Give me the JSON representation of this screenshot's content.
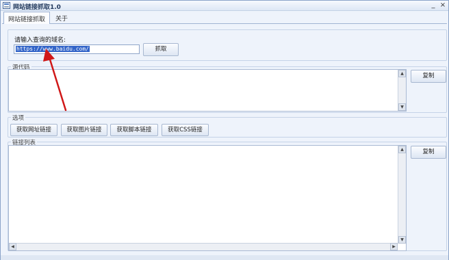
{
  "window": {
    "title": "网站链接抓取1.0",
    "minimize": "_",
    "close": "×"
  },
  "tabs": [
    {
      "label": "网站链接抓取"
    },
    {
      "label": "关于"
    }
  ],
  "url_section": {
    "prompt": "请输入查询的域名:",
    "input_value": "https://www.baidu.com/",
    "fetch_button": "抓取"
  },
  "source_section": {
    "legend": "源代码",
    "content": "",
    "copy_button": "复制"
  },
  "options_section": {
    "legend": "选项",
    "buttons": [
      "获取网址链接",
      "获取图片链接",
      "获取脚本链接",
      "获取CSS链接"
    ]
  },
  "links_section": {
    "legend": "链接列表",
    "content": "",
    "copy_button": "复制"
  },
  "colors": {
    "arrow": "#d01818",
    "selection": "#3264c8",
    "window_bg": "#eef3fb"
  }
}
